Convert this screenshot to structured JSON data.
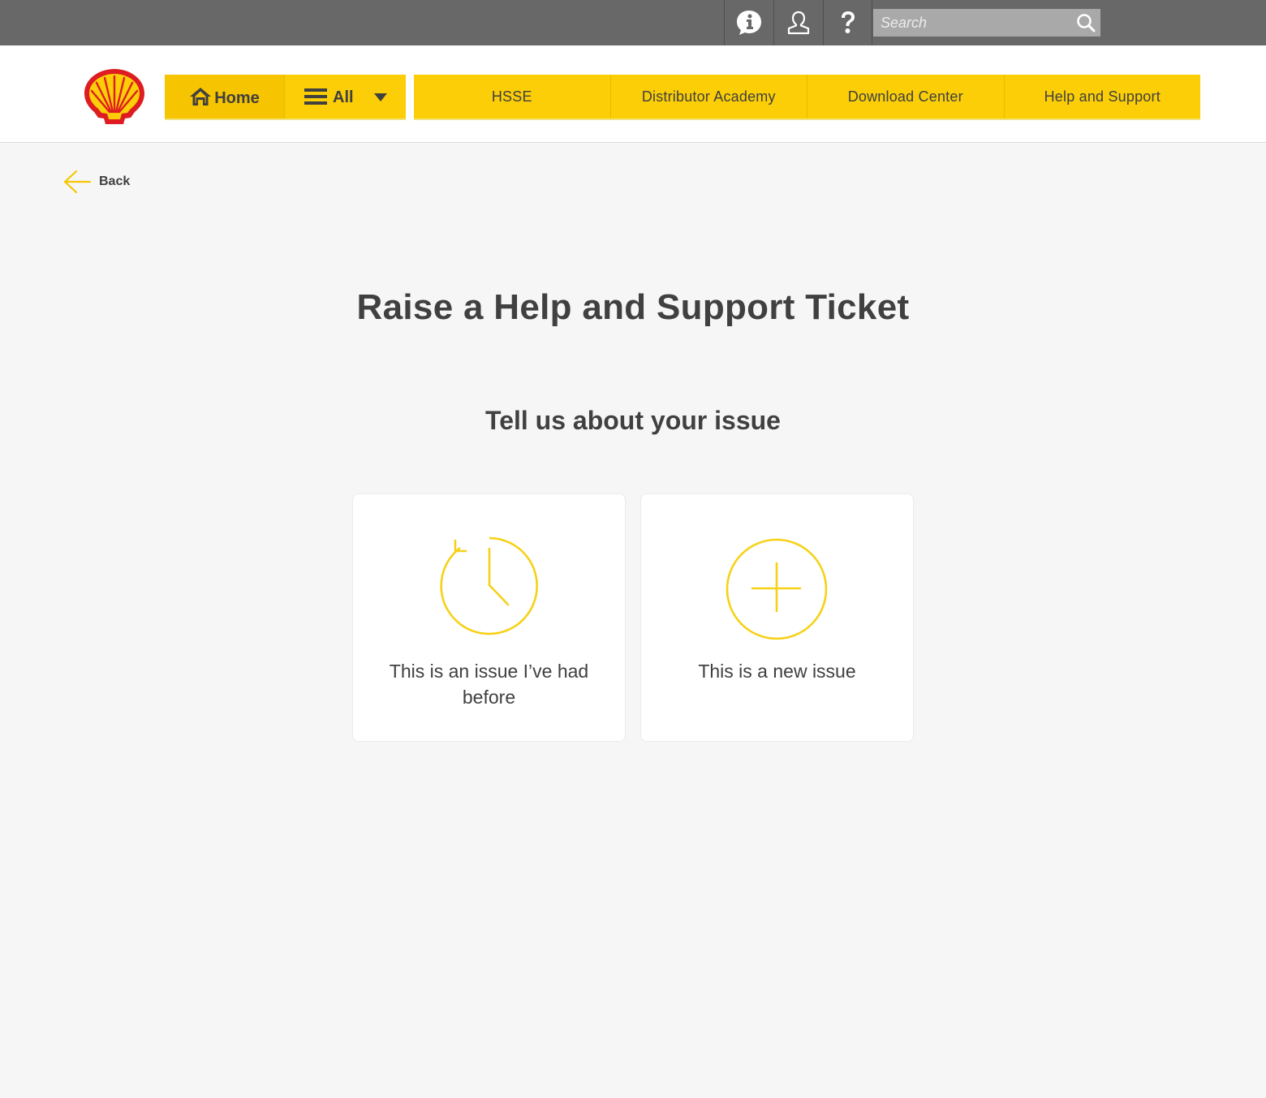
{
  "topbar": {
    "icons": [
      "info-icon",
      "user-icon",
      "help-icon"
    ],
    "search_placeholder": "Search"
  },
  "header": {
    "logo": "shell-logo",
    "nav_home_label": "Home",
    "nav_all_label": "All",
    "nav_items": [
      "HSSE",
      "Distributor Academy",
      "Download Center",
      "Help and Support"
    ]
  },
  "back_label": "Back",
  "title": "Raise a Help and Support Ticket",
  "subtitle": "Tell us about your issue",
  "options": [
    {
      "icon": "history-clock-icon",
      "label": "This is an issue I’ve had before"
    },
    {
      "icon": "plus-circle-icon",
      "label": "This is a new issue"
    }
  ],
  "colors": {
    "accent": "#fbce07",
    "icon_yellow": "#f7d117",
    "topbar": "#686868",
    "text": "#404040",
    "background": "#f6f6f6"
  }
}
